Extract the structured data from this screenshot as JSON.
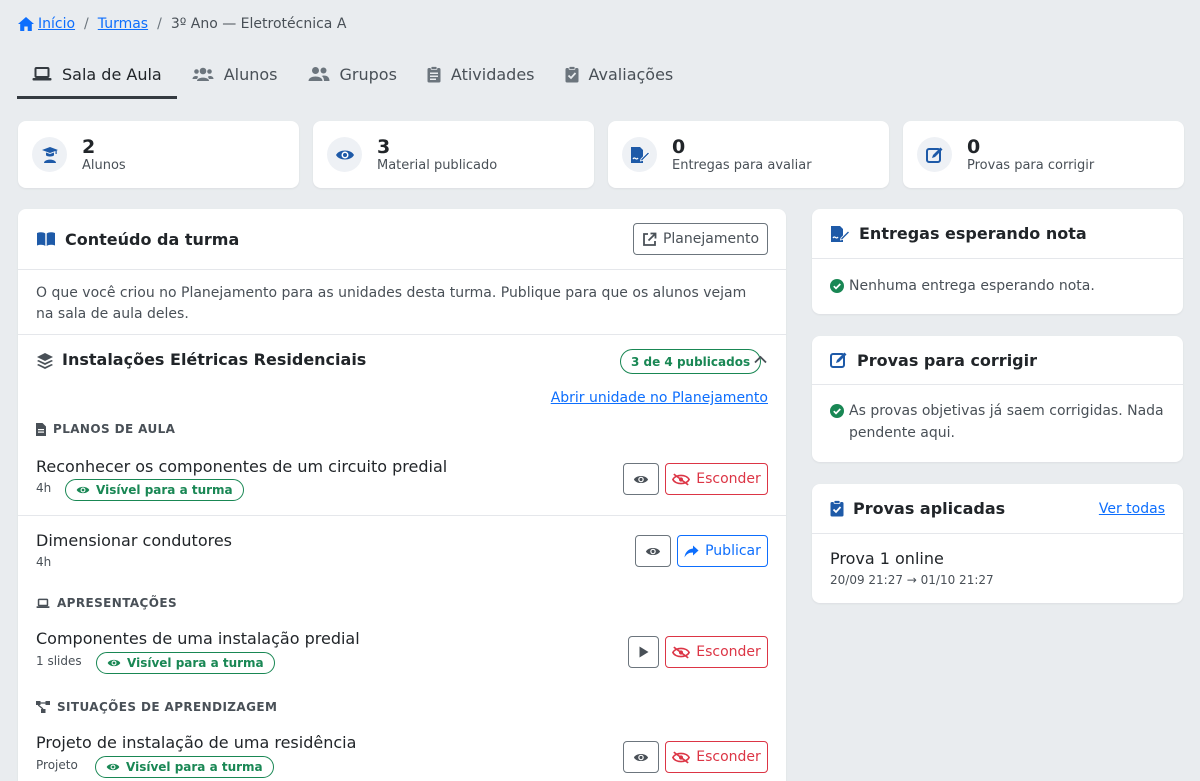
{
  "breadcrumb": {
    "home": "Início",
    "turmas": "Turmas",
    "current": "3º Ano — Eletrotécnica A",
    "separator": "/"
  },
  "tabs": [
    {
      "label": "Sala de Aula",
      "icon": "laptop-icon",
      "active": true
    },
    {
      "label": "Alunos",
      "icon": "users-icon"
    },
    {
      "label": "Grupos",
      "icon": "user-group-icon"
    },
    {
      "label": "Atividades",
      "icon": "clipboard-list-icon"
    },
    {
      "label": "Avaliações",
      "icon": "clipboard-check-icon"
    }
  ],
  "stats": [
    {
      "value": "2",
      "label": "Alunos",
      "icon": "graduate-icon"
    },
    {
      "value": "3",
      "label": "Material publicado",
      "icon": "eye-icon"
    },
    {
      "value": "0",
      "label": "Entregas para avaliar",
      "icon": "file-signature-icon"
    },
    {
      "value": "0",
      "label": "Provas para corrigir",
      "icon": "edit-icon"
    }
  ],
  "content": {
    "title": "Conteúdo da turma",
    "planning_button": "Planejamento",
    "description": "O que você criou no Planejamento para as unidades desta turma. Publique para que os alunos vejam na sala de aula deles.",
    "unit": {
      "title": "Instalações Elétricas Residenciais",
      "badge": "3 de 4 publicados",
      "open_link": "Abrir unidade no Planejamento"
    },
    "sections": {
      "lesson_plans": "PLANOS DE AULA",
      "presentations": "APRESENTAÇÕES",
      "situations": "SITUAÇÕES DE APRENDIZAGEM"
    },
    "items": [
      {
        "title": "Reconhecer os componentes de um circuito predial",
        "meta": "4h",
        "badge": "Visível para a turma",
        "action": "Esconder"
      },
      {
        "title": "Dimensionar condutores",
        "meta": "4h",
        "action": "Publicar"
      },
      {
        "title": "Componentes de uma instalação predial",
        "meta": "1 slides",
        "badge": "Visível para a turma",
        "action": "Esconder"
      },
      {
        "title": "Projeto de instalação de uma residência",
        "meta": "Projeto",
        "badge": "Visível para a turma",
        "action": "Esconder"
      }
    ]
  },
  "pending": {
    "title": "Entregas esperando nota",
    "message": "Nenhuma entrega esperando nota."
  },
  "grading": {
    "title": "Provas para corrigir",
    "message": "As provas objetivas já saem corrigidas. Nada pendente aqui."
  },
  "applied": {
    "title": "Provas aplicadas",
    "see_all": "Ver todas",
    "exam_title": "Prova 1 online",
    "exam_dates": "20/09 21:27 → 01/10 21:27"
  },
  "colors": {
    "primary": "#0d6efd",
    "icon_blue": "#1e5aa8",
    "success": "#198754",
    "danger": "#dc3545"
  }
}
